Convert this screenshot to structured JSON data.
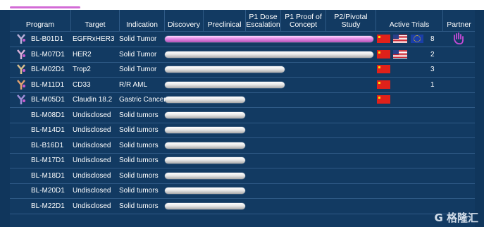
{
  "headers": [
    "Program",
    "Target",
    "Indication",
    "Discovery",
    "Preclinical",
    "P1 Dose\nEscalation",
    "P1 Proof of\nConcept",
    "P2/Pivotal\nStudy",
    "Active Trials",
    "Partner"
  ],
  "rows": [
    {
      "program": "BL-B01D1",
      "target": "EGFRxHER3",
      "indication": "Solid Tumor",
      "stage_label": "P2/Pivotal Study",
      "flags": [
        "china-flag-icon",
        "us-flag-icon",
        "eu-flag-icon"
      ],
      "trials": "8",
      "partner_icon": "partner-hand-icon",
      "pink": true
    },
    {
      "program": "BL-M07D1",
      "target": "HER2",
      "indication": "Solid Tumor",
      "stage_label": "P2/Pivotal Study",
      "flags": [
        "china-flag-icon",
        "us-flag-icon"
      ],
      "trials": "2"
    },
    {
      "program": "BL-M02D1",
      "target": "Trop2",
      "indication": "Solid Tumor",
      "stage_label": "P1 Dose Escalation",
      "flags": [
        "china-flag-icon"
      ],
      "trials": "3"
    },
    {
      "program": "BL-M11D1",
      "target": "CD33",
      "indication": "R/R AML",
      "stage_label": "P1 Dose Escalation",
      "flags": [
        "china-flag-icon"
      ],
      "trials": "1"
    },
    {
      "program": "BL-M05D1",
      "target": "Claudin 18.2",
      "indication": "Gastric Cancer",
      "stage_label": "Preclinical",
      "flags": [
        "china-flag-icon"
      ],
      "trials": ""
    },
    {
      "program": "BL-M08D1",
      "target": "Undisclosed",
      "indication": "Solid tumors",
      "stage_label": "Preclinical",
      "flags": [],
      "trials": ""
    },
    {
      "program": "BL-M14D1",
      "target": "Undisclosed",
      "indication": "Solid tumors",
      "stage_label": "Preclinical",
      "flags": [],
      "trials": ""
    },
    {
      "program": "BL-B16D1",
      "target": "Undisclosed",
      "indication": "Solid tumors",
      "stage_label": "Preclinical",
      "flags": [],
      "trials": ""
    },
    {
      "program": "BL-M17D1",
      "target": "Undisclosed",
      "indication": "Solid tumors",
      "stage_label": "Preclinical",
      "flags": [],
      "trials": ""
    },
    {
      "program": "BL-M18D1",
      "target": "Undisclosed",
      "indication": "Solid tumors",
      "stage_label": "Preclinical",
      "flags": [],
      "trials": ""
    },
    {
      "program": "BL-M20D1",
      "target": "Undisclosed",
      "indication": "Solid tumors",
      "stage_label": "Preclinical",
      "flags": [],
      "trials": ""
    },
    {
      "program": "BL-M22D1",
      "target": "Undisclosed",
      "indication": "Solid tumors",
      "stage_label": "Preclinical",
      "flags": [],
      "trials": ""
    }
  ],
  "row_icons": [
    "adc-icon-1",
    "adc-icon-2",
    "adc-icon-3",
    "adc-icon-4",
    "adc-icon-5"
  ],
  "watermark": "G 格隆汇",
  "colors": {
    "background": "#10365c",
    "grid": "#2f5a86",
    "accent_pink": "#d36ad6",
    "china_red": "#e0211a"
  }
}
